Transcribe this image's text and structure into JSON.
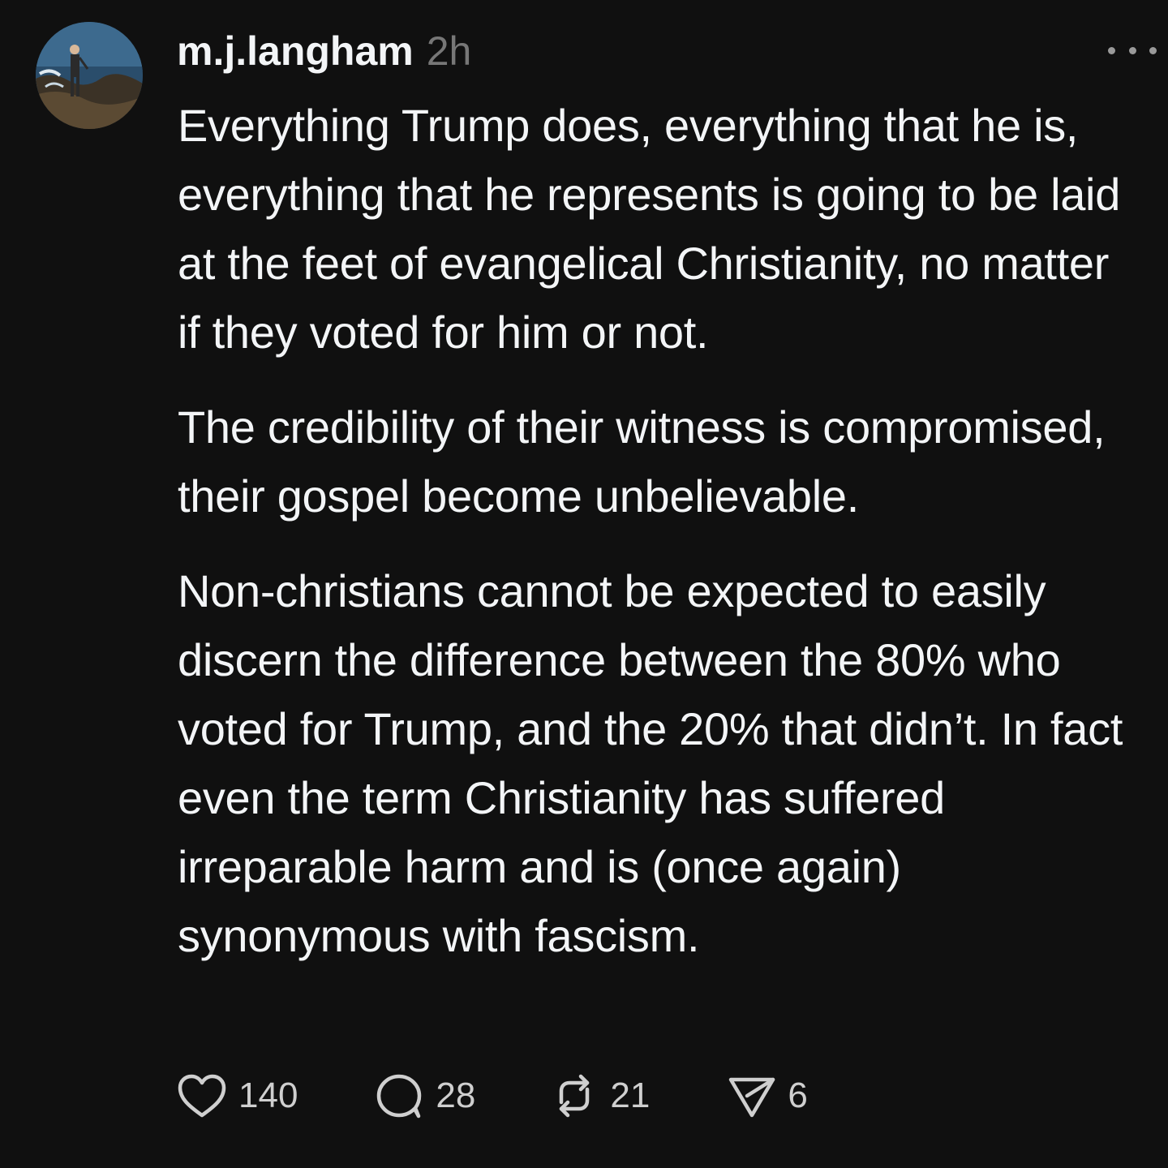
{
  "post": {
    "avatar_icon": "profile-photo-icon",
    "username": "m.j.langham",
    "timestamp": "2h",
    "more_icon": "more-options-icon",
    "paragraphs": [
      "Everything Trump does, everything that he is, everything that he represents is going to be laid at the feet of evangelical Christianity, no matter if they voted for him or not.",
      "The credibility of their witness is compromised, their gospel become unbelievable.",
      "Non-christians cannot be expected to easily discern the difference between the 80% who voted for Trump, and the 20% that didn’t. In fact even the term Christianity has suffered irreparable harm and is (once again) synonymous with fascism."
    ],
    "actions": {
      "like": {
        "icon": "heart-icon",
        "count": "140"
      },
      "reply": {
        "icon": "comment-icon",
        "count": "28"
      },
      "repost": {
        "icon": "repost-icon",
        "count": "21"
      },
      "share": {
        "icon": "send-icon",
        "count": "6"
      }
    }
  },
  "colors": {
    "background": "#101010",
    "text_primary": "#f3f5f7",
    "text_secondary": "#777777",
    "icon": "#cfcfcf"
  }
}
